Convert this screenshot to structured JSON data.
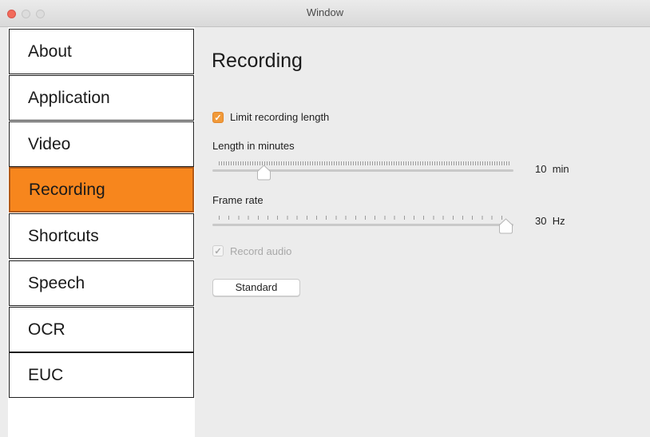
{
  "window": {
    "title": "Window"
  },
  "sidebar": {
    "items": [
      {
        "label": "About"
      },
      {
        "label": "Application"
      },
      {
        "label": "Video"
      },
      {
        "label": "Recording"
      },
      {
        "label": "Shortcuts"
      },
      {
        "label": "Speech"
      },
      {
        "label": "OCR"
      },
      {
        "label": "EUC"
      }
    ],
    "selected": "Recording",
    "selected_color": "#f7861d"
  },
  "main": {
    "title": "Recording",
    "limit_checkbox": {
      "label": "Limit recording length",
      "checked": true
    },
    "length": {
      "label": "Length in minutes",
      "value": "10",
      "unit": "min"
    },
    "frame_rate": {
      "label": "Frame rate",
      "value": "30",
      "unit": "Hz"
    },
    "audio_checkbox": {
      "label": "Record audio",
      "checked": true,
      "enabled": false
    },
    "standard_button": {
      "label": "Standard"
    }
  }
}
